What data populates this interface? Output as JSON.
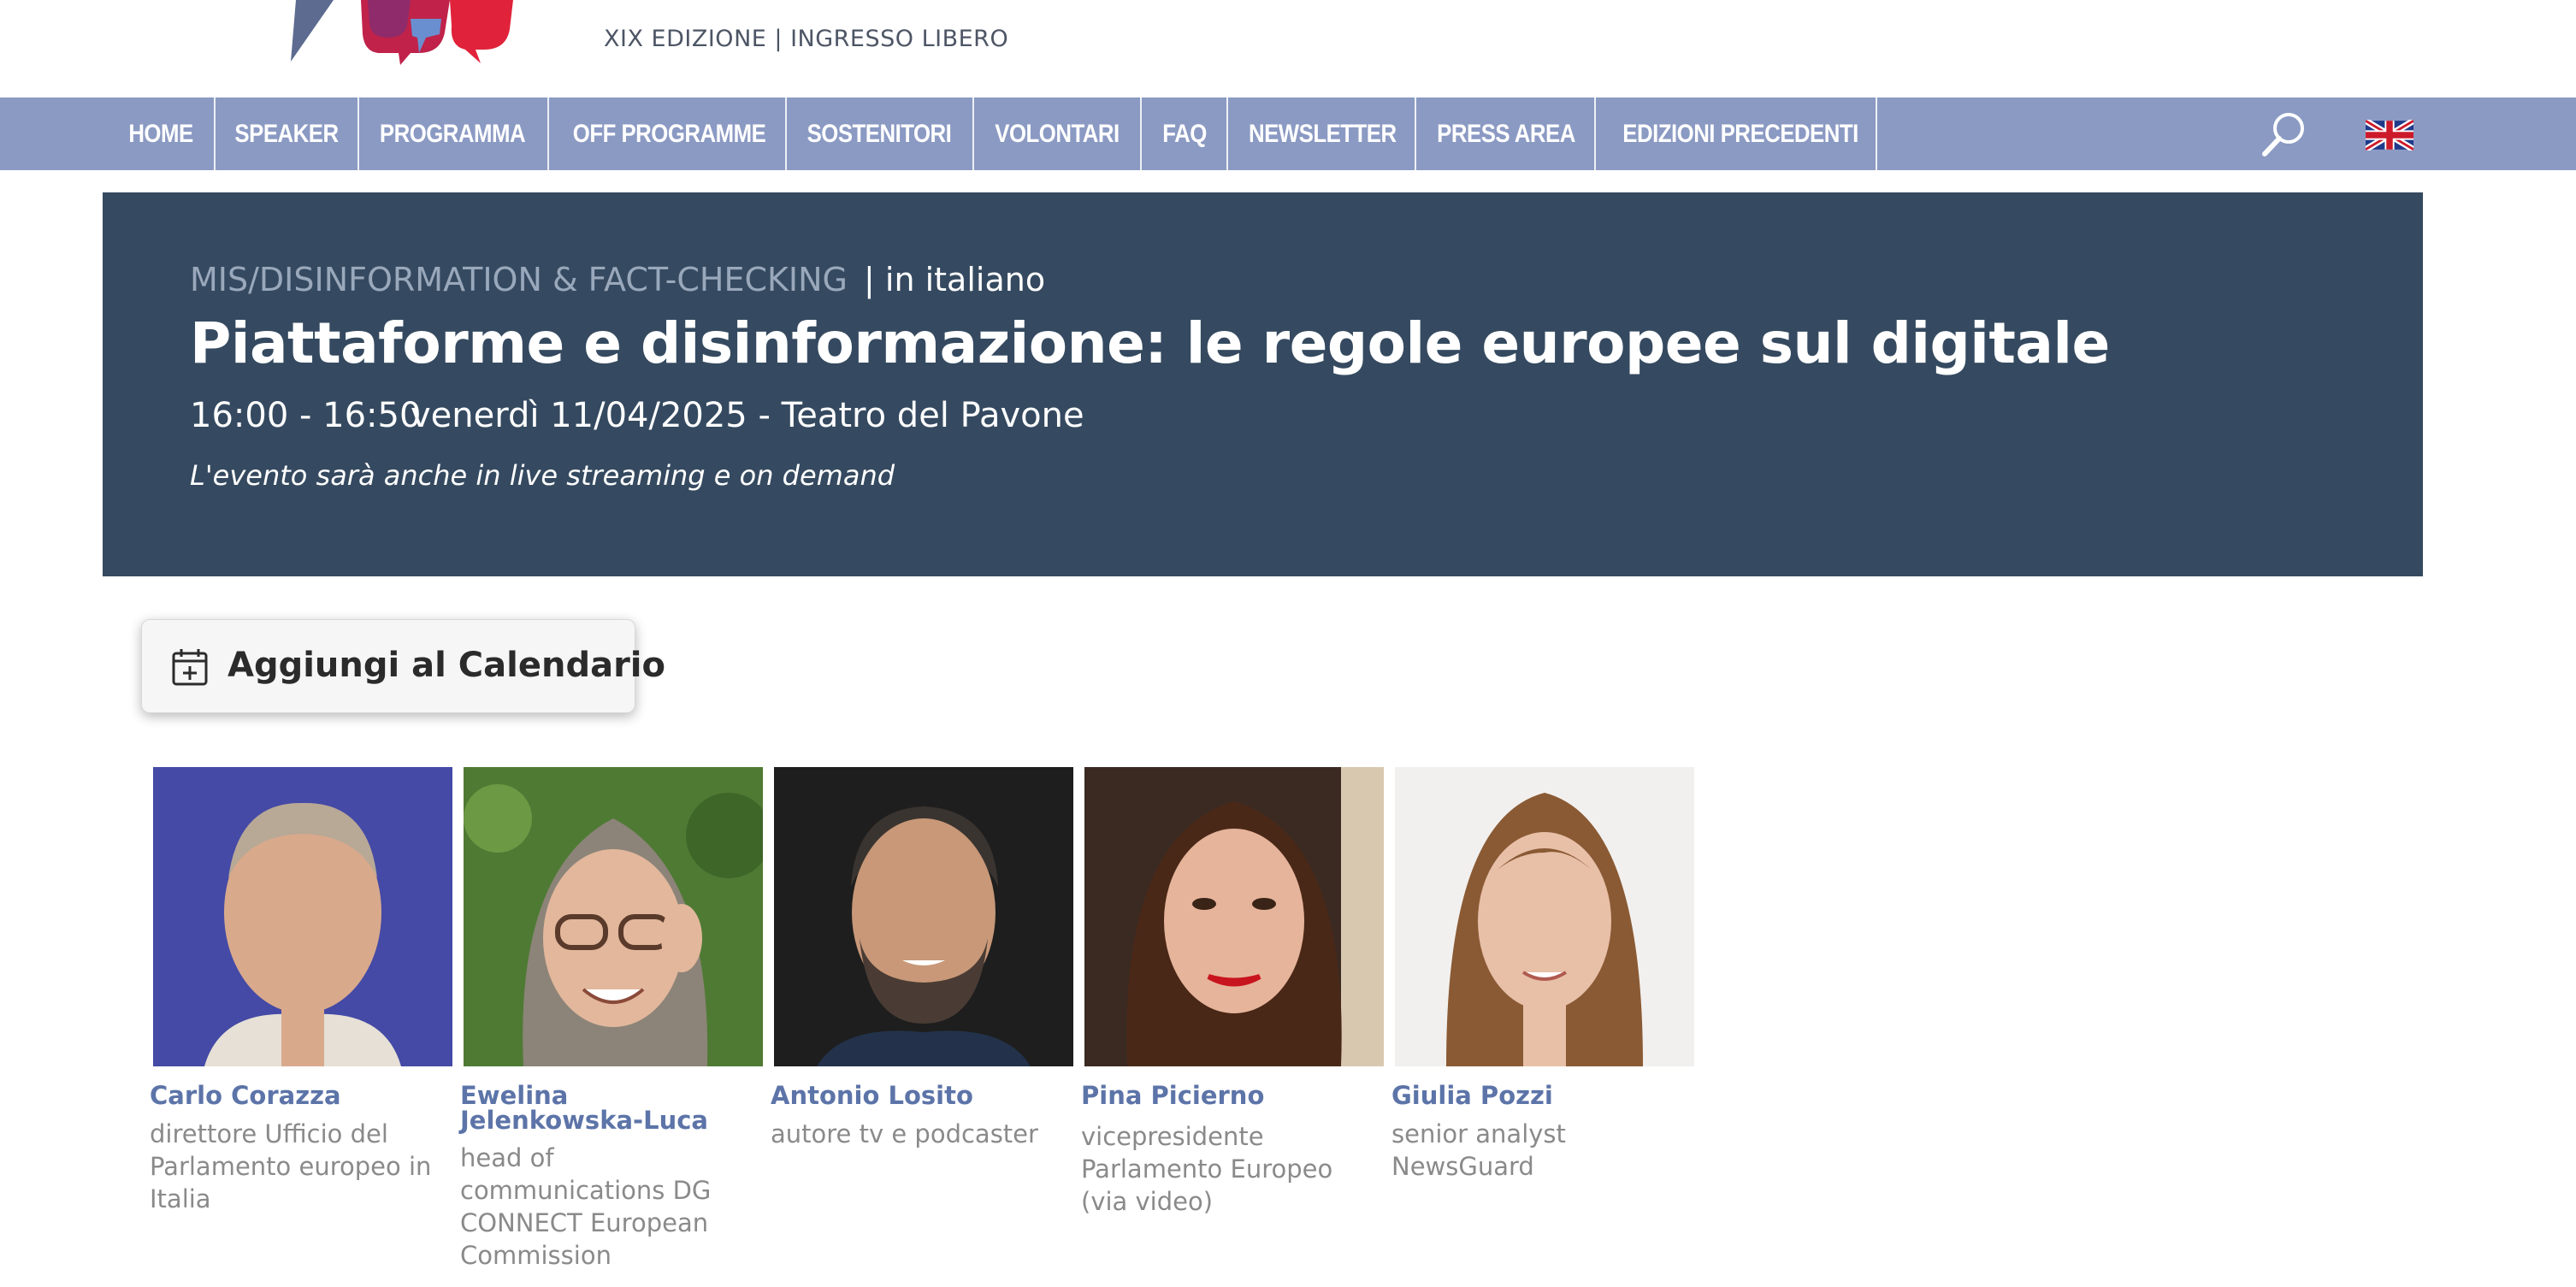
{
  "header": {
    "edition_text": "XIX EDIZIONE | INGRESSO LIBERO"
  },
  "nav": {
    "items": [
      "HOME",
      "SPEAKER",
      "PROGRAMMA",
      "OFF PROGRAMME",
      "SOSTENITORI",
      "VOLONTARI",
      "FAQ",
      "NEWSLETTER",
      "PRESS AREA",
      "EDIZIONI PRECEDENTI"
    ],
    "search_icon": "search-icon",
    "language_icon": "uk-flag-icon"
  },
  "event": {
    "category": "MIS/DISINFORMATION & FACT-CHECKING",
    "language": "| in italiano",
    "title": "Piattaforme e disinformazione: le regole europee sul digitale",
    "time": "16:00 - 16:50",
    "date_place": "venerdì 11/04/2025 - Teatro del Pavone",
    "streaming_note": "L'evento sarà anche in live streaming e on demand"
  },
  "calendar_button": {
    "label": "Aggiungi al Calendario",
    "icon": "calendar-add-icon"
  },
  "speakers": [
    {
      "name": "Carlo Corazza",
      "role": "direttore Ufficio del Parlamento europeo in Italia"
    },
    {
      "name": "Ewelina Jelenkowska-Luca",
      "role": "head of communications DG CONNECT European Commission"
    },
    {
      "name": "Antonio Losito",
      "role": "autore tv e podcaster"
    },
    {
      "name": "Pina Picierno",
      "role": "vicepresidente Parlamento Europeo (via video)"
    },
    {
      "name": "Giulia Pozzi",
      "role": "senior analyst NewsGuard"
    }
  ],
  "colors": {
    "nav_bg": "#8b9ac3",
    "hero_bg": "#354a60",
    "speaker_name": "#5c74a8"
  }
}
